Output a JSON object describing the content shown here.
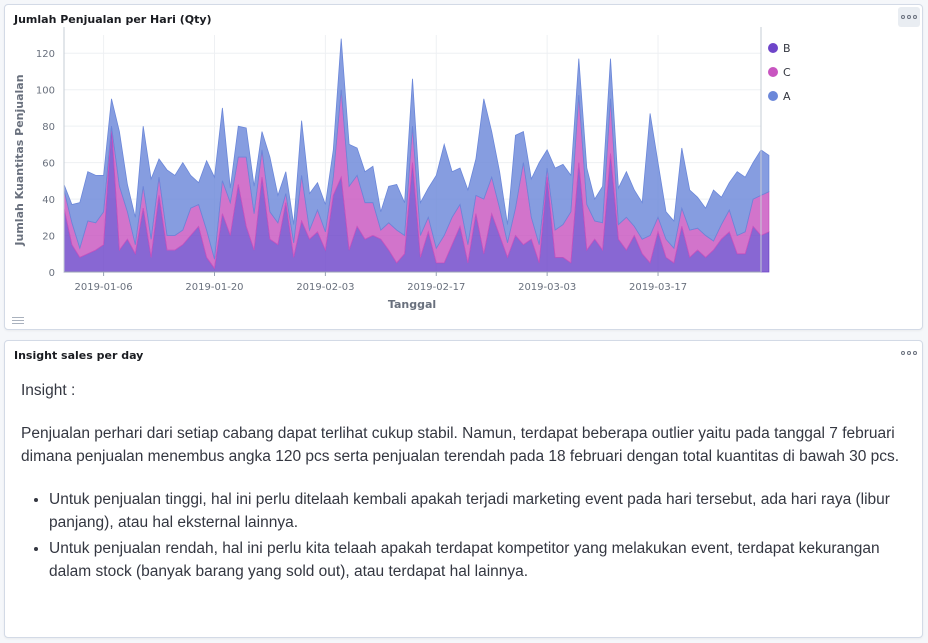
{
  "chart_panel": {
    "title": "Jumlah Penjualan per Hari (Qty)"
  },
  "insight_panel": {
    "title": "Insight sales per day",
    "heading": "Insight :",
    "paragraph": "Penjualan perhari dari setiap cabang dapat terlihat cukup stabil. Namun, terdapat beberapa outlier yaitu pada tanggal 7 februari dimana penjualan menembus angka 120 pcs serta penjualan terendah pada 18 februari dengan total kuantitas di bawah 30 pcs.",
    "bullets": [
      "Untuk penjualan tinggi, hal ini perlu ditelaah kembali apakah terjadi marketing event pada hari tersebut, ada hari raya (libur panjang), atau hal eksternal lainnya.",
      "Untuk penjualan rendah, hal ini perlu kita telaah apakah terdapat kompetitor yang melakukan event, terdapat kekurangan dalam stock (banyak barang yang sold out), atau terdapat hal lainnya."
    ]
  },
  "icons": [
    "panel-options-icon",
    "legend-toggle-icon"
  ],
  "chart_data": {
    "type": "area",
    "stacked": true,
    "xlabel": "Tanggal",
    "ylabel": "Jumlah Kuantitas Penjualan",
    "ylim": [
      0,
      130
    ],
    "y_ticks": [
      0,
      20,
      40,
      60,
      80,
      100,
      120
    ],
    "x_start": "2019-01-01",
    "x_end": "2019-03-30",
    "x_ticks": [
      "2019-01-06",
      "2019-01-20",
      "2019-02-03",
      "2019-02-17",
      "2019-03-03",
      "2019-03-17"
    ],
    "grid": true,
    "legend_position": "top-right",
    "series": [
      {
        "name": "B",
        "color": "#6e45c9",
        "values": [
          35,
          15,
          8,
          10,
          12,
          15,
          80,
          12,
          18,
          10,
          35,
          8,
          42,
          12,
          12,
          15,
          20,
          25,
          8,
          2,
          32,
          20,
          48,
          25,
          12,
          52,
          18,
          15,
          38,
          8,
          28,
          18,
          22,
          12,
          42,
          52,
          12,
          25,
          18,
          20,
          18,
          12,
          5,
          10,
          60,
          8,
          22,
          5,
          5,
          15,
          25,
          5,
          32,
          10,
          32,
          20,
          8,
          20,
          15,
          18,
          5,
          52,
          8,
          8,
          5,
          60,
          12,
          18,
          12,
          65,
          18,
          12,
          20,
          10,
          5,
          22,
          8,
          5,
          25,
          8,
          12,
          8,
          12,
          18,
          22,
          10,
          10,
          25,
          20,
          22
        ]
      },
      {
        "name": "C",
        "color": "#c855c0",
        "values": [
          10,
          12,
          5,
          18,
          15,
          18,
          0,
          35,
          15,
          5,
          12,
          10,
          10,
          8,
          8,
          8,
          15,
          12,
          15,
          5,
          18,
          18,
          15,
          38,
          20,
          15,
          15,
          12,
          5,
          8,
          25,
          5,
          12,
          10,
          10,
          48,
          35,
          28,
          20,
          18,
          5,
          15,
          18,
          10,
          20,
          12,
          8,
          8,
          15,
          15,
          12,
          10,
          10,
          30,
          20,
          15,
          8,
          15,
          45,
          12,
          10,
          5,
          15,
          18,
          28,
          37,
          25,
          10,
          15,
          30,
          8,
          18,
          5,
          8,
          15,
          8,
          10,
          8,
          10,
          15,
          12,
          12,
          5,
          8,
          12,
          10,
          12,
          15,
          22,
          22
        ]
      },
      {
        "name": "A",
        "color": "#6b87d9",
        "values": [
          3,
          10,
          25,
          27,
          26,
          20,
          15,
          30,
          15,
          15,
          33,
          33,
          10,
          36,
          33,
          37,
          18,
          12,
          38,
          45,
          40,
          8,
          17,
          16,
          15,
          10,
          30,
          15,
          12,
          10,
          30,
          20,
          15,
          15,
          15,
          28,
          23,
          15,
          17,
          20,
          10,
          20,
          25,
          18,
          26,
          18,
          16,
          40,
          50,
          25,
          20,
          30,
          20,
          55,
          25,
          20,
          10,
          40,
          17,
          21,
          45,
          10,
          34,
          33,
          20,
          20,
          20,
          12,
          20,
          22,
          20,
          25,
          20,
          20,
          67,
          30,
          15,
          15,
          33,
          22,
          17,
          15,
          28,
          15,
          15,
          35,
          30,
          20,
          25,
          20
        ]
      }
    ]
  }
}
